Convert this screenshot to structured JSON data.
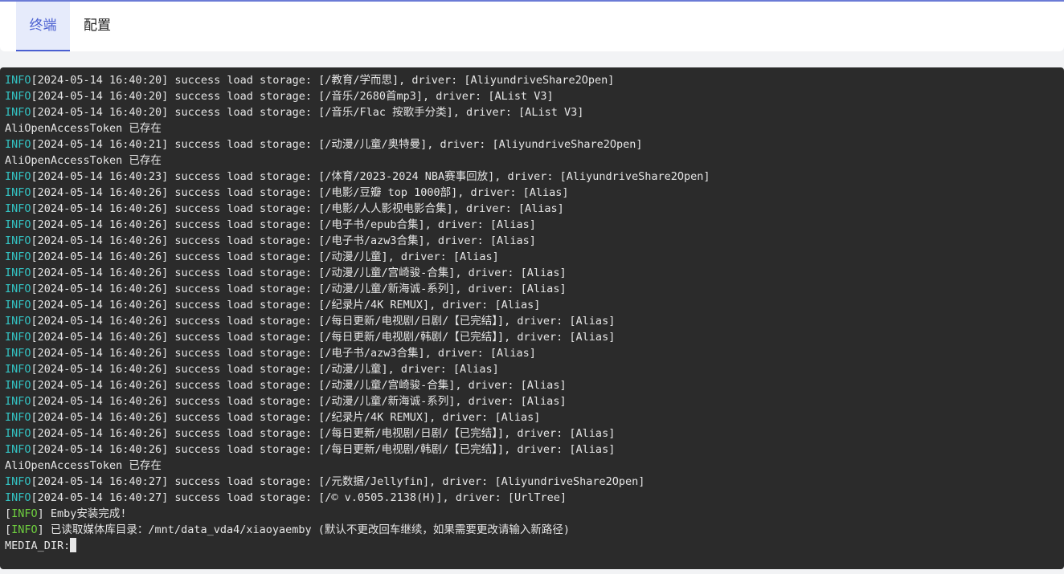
{
  "tabs": [
    {
      "label": "终端",
      "active": true
    },
    {
      "label": "配置",
      "active": false
    }
  ],
  "colors": {
    "accent": "#4a5fd1",
    "terminal_bg": "#2b2b2b",
    "info_level": "#33c3c3",
    "info_tag": "#6fd13f"
  },
  "terminal": {
    "lines": [
      {
        "level": "INFO",
        "text": "[2024-05-14 16:40:20] success load storage: [/教育/学而思], driver: [AliyundriveShare2Open]"
      },
      {
        "level": "INFO",
        "text": "[2024-05-14 16:40:20] success load storage: [/音乐/2680首mp3], driver: [AList V3]"
      },
      {
        "level": "INFO",
        "text": "[2024-05-14 16:40:20] success load storage: [/音乐/Flac 按歌手分类], driver: [AList V3]"
      },
      {
        "level": "",
        "text": "AliOpenAccessToken 已存在"
      },
      {
        "level": "INFO",
        "text": "[2024-05-14 16:40:21] success load storage: [/动漫/儿童/奥特曼], driver: [AliyundriveShare2Open]"
      },
      {
        "level": "",
        "text": "AliOpenAccessToken 已存在"
      },
      {
        "level": "INFO",
        "text": "[2024-05-14 16:40:23] success load storage: [/体育/2023-2024 NBA赛事回放], driver: [AliyundriveShare2Open]"
      },
      {
        "level": "INFO",
        "text": "[2024-05-14 16:40:26] success load storage: [/电影/豆瓣 top 1000部], driver: [Alias]"
      },
      {
        "level": "INFO",
        "text": "[2024-05-14 16:40:26] success load storage: [/电影/人人影视电影合集], driver: [Alias]"
      },
      {
        "level": "INFO",
        "text": "[2024-05-14 16:40:26] success load storage: [/电子书/epub合集], driver: [Alias]"
      },
      {
        "level": "INFO",
        "text": "[2024-05-14 16:40:26] success load storage: [/电子书/azw3合集], driver: [Alias]"
      },
      {
        "level": "INFO",
        "text": "[2024-05-14 16:40:26] success load storage: [/动漫/儿童], driver: [Alias]"
      },
      {
        "level": "INFO",
        "text": "[2024-05-14 16:40:26] success load storage: [/动漫/儿童/宫崎骏-合集], driver: [Alias]"
      },
      {
        "level": "INFO",
        "text": "[2024-05-14 16:40:26] success load storage: [/动漫/儿童/新海诚-系列], driver: [Alias]"
      },
      {
        "level": "INFO",
        "text": "[2024-05-14 16:40:26] success load storage: [/纪录片/4K REMUX], driver: [Alias]"
      },
      {
        "level": "INFO",
        "text": "[2024-05-14 16:40:26] success load storage: [/每日更新/电视剧/日剧/【已完结】], driver: [Alias]"
      },
      {
        "level": "INFO",
        "text": "[2024-05-14 16:40:26] success load storage: [/每日更新/电视剧/韩剧/【已完结】], driver: [Alias]"
      },
      {
        "level": "INFO",
        "text": "[2024-05-14 16:40:26] success load storage: [/电子书/azw3合集], driver: [Alias]"
      },
      {
        "level": "INFO",
        "text": "[2024-05-14 16:40:26] success load storage: [/动漫/儿童], driver: [Alias]"
      },
      {
        "level": "INFO",
        "text": "[2024-05-14 16:40:26] success load storage: [/动漫/儿童/宫崎骏-合集], driver: [Alias]"
      },
      {
        "level": "INFO",
        "text": "[2024-05-14 16:40:26] success load storage: [/动漫/儿童/新海诚-系列], driver: [Alias]"
      },
      {
        "level": "INFO",
        "text": "[2024-05-14 16:40:26] success load storage: [/纪录片/4K REMUX], driver: [Alias]"
      },
      {
        "level": "INFO",
        "text": "[2024-05-14 16:40:26] success load storage: [/每日更新/电视剧/日剧/【已完结】], driver: [Alias]"
      },
      {
        "level": "INFO",
        "text": "[2024-05-14 16:40:26] success load storage: [/每日更新/电视剧/韩剧/【已完结】], driver: [Alias]"
      },
      {
        "level": "",
        "text": "AliOpenAccessToken 已存在"
      },
      {
        "level": "INFO",
        "text": "[2024-05-14 16:40:27] success load storage: [/元数据/Jellyfin], driver: [AliyundriveShare2Open]"
      },
      {
        "level": "INFO",
        "text": "[2024-05-14 16:40:27] success load storage: [/© v.0505.2138(H)], driver: [UrlTree]"
      },
      {
        "level": "[INFO]",
        "text": " Emby安装完成!"
      },
      {
        "level": "[INFO]",
        "text": " 已读取媒体库目录：/mnt/data_vda4/xiaoyaemby (默认不更改回车继续，如果需要更改请输入新路径)"
      }
    ],
    "prompt": "MEDIA_DIR:"
  }
}
